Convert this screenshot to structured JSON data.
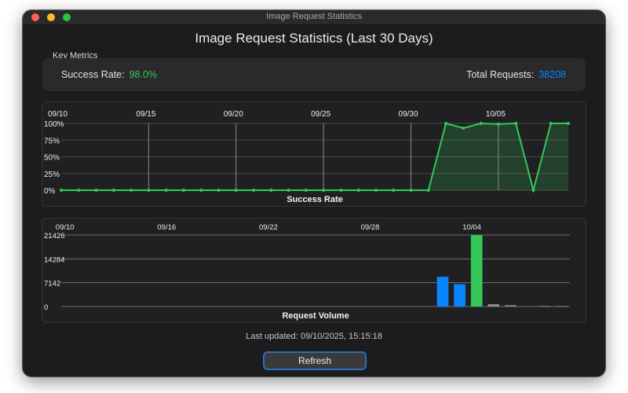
{
  "window": {
    "title": "Image Request Statistics"
  },
  "header": {
    "title": "Image Request Statistics (Last 30 Days)"
  },
  "metrics": {
    "section_label": "Key Metrics",
    "success_rate_label": "Success Rate:",
    "success_rate_value": "98.0%",
    "total_requests_label": "Total Requests:",
    "total_requests_value": "38208"
  },
  "colors": {
    "success": "#34c759",
    "accent": "#0a84ff",
    "muted_bar": "#8e8e93"
  },
  "chart_data": [
    {
      "type": "area",
      "title": "Success Rate",
      "x_tick_labels": [
        "09/10",
        "09/15",
        "09/20",
        "09/25",
        "09/30",
        "10/05"
      ],
      "y_tick_labels": [
        "100%",
        "75%",
        "50%",
        "25%",
        "0%"
      ],
      "ylim": [
        0,
        100
      ],
      "x": [
        "09/10",
        "09/11",
        "09/12",
        "09/13",
        "09/14",
        "09/15",
        "09/16",
        "09/17",
        "09/18",
        "09/19",
        "09/20",
        "09/21",
        "09/22",
        "09/23",
        "09/24",
        "09/25",
        "09/26",
        "09/27",
        "09/28",
        "09/29",
        "09/30",
        "10/01",
        "10/02",
        "10/03",
        "10/04",
        "10/05",
        "10/06",
        "10/07",
        "10/08",
        "10/09"
      ],
      "values": [
        0,
        0,
        0,
        0,
        0,
        0,
        0,
        0,
        0,
        0,
        0,
        0,
        0,
        0,
        0,
        0,
        0,
        0,
        0,
        0,
        0,
        0,
        100,
        93,
        100,
        99,
        100,
        0,
        100,
        100
      ],
      "grid": true
    },
    {
      "type": "bar",
      "title": "Request Volume",
      "x_tick_labels": [
        "09/10",
        "09/16",
        "09/22",
        "09/28",
        "10/04"
      ],
      "y_tick_labels": [
        "21426",
        "14284",
        "7142",
        "0"
      ],
      "ylim": [
        0,
        21426
      ],
      "categories": [
        "09/10",
        "09/11",
        "09/12",
        "09/13",
        "09/14",
        "09/15",
        "09/16",
        "09/17",
        "09/18",
        "09/19",
        "09/20",
        "09/21",
        "09/22",
        "09/23",
        "09/24",
        "09/25",
        "09/26",
        "09/27",
        "09/28",
        "09/29",
        "09/30",
        "10/01",
        "10/02",
        "10/03",
        "10/04",
        "10/05",
        "10/06",
        "10/07",
        "10/08",
        "10/09"
      ],
      "values": [
        0,
        0,
        0,
        0,
        0,
        0,
        0,
        0,
        0,
        0,
        0,
        0,
        0,
        0,
        0,
        0,
        0,
        0,
        0,
        0,
        0,
        0,
        8900,
        6700,
        21426,
        700,
        400,
        0,
        150,
        150
      ],
      "bar_color_keys": [
        "muted_bar",
        "muted_bar",
        "muted_bar",
        "muted_bar",
        "muted_bar",
        "muted_bar",
        "muted_bar",
        "muted_bar",
        "muted_bar",
        "muted_bar",
        "muted_bar",
        "muted_bar",
        "muted_bar",
        "muted_bar",
        "muted_bar",
        "muted_bar",
        "muted_bar",
        "muted_bar",
        "muted_bar",
        "muted_bar",
        "muted_bar",
        "muted_bar",
        "accent",
        "accent",
        "success",
        "muted_bar",
        "muted_bar",
        "muted_bar",
        "muted_bar",
        "muted_bar"
      ],
      "grid": true
    }
  ],
  "footer": {
    "last_updated": "Last updated: 09/10/2025, 15:15:18",
    "refresh_label": "Refresh"
  }
}
